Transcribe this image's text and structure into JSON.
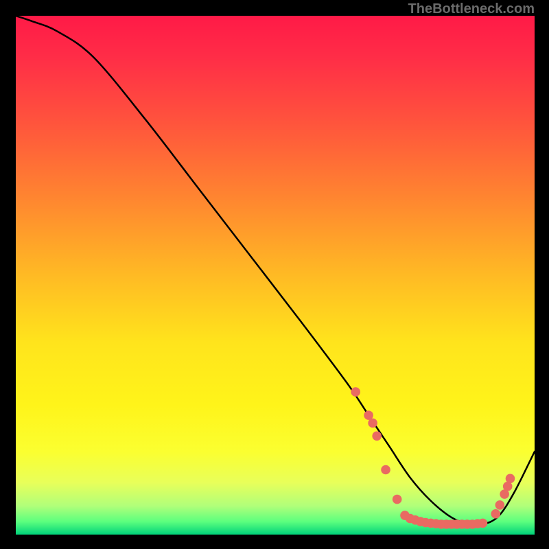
{
  "attribution": "TheBottleneck.com",
  "chart_data": {
    "type": "line",
    "title": "",
    "xlabel": "",
    "ylabel": "",
    "xlim": [
      0,
      100
    ],
    "ylim": [
      0,
      100
    ],
    "grid": false,
    "gradient_stops": [
      {
        "offset": 0,
        "color": "#ff1a47"
      },
      {
        "offset": 0.08,
        "color": "#ff2d47"
      },
      {
        "offset": 0.2,
        "color": "#ff523d"
      },
      {
        "offset": 0.35,
        "color": "#ff8530"
      },
      {
        "offset": 0.5,
        "color": "#ffba24"
      },
      {
        "offset": 0.63,
        "color": "#ffe41c"
      },
      {
        "offset": 0.75,
        "color": "#fff41a"
      },
      {
        "offset": 0.84,
        "color": "#fbff30"
      },
      {
        "offset": 0.9,
        "color": "#e8ff5a"
      },
      {
        "offset": 0.945,
        "color": "#b0ff7a"
      },
      {
        "offset": 0.975,
        "color": "#5cff7e"
      },
      {
        "offset": 1.0,
        "color": "#00d27a"
      }
    ],
    "series": [
      {
        "name": "bottleneck-curve",
        "color": "#000000",
        "x": [
          0,
          3,
          8,
          15,
          25,
          35,
          45,
          55,
          64,
          68,
          72,
          76,
          80,
          84,
          87,
          90,
          93,
          96,
          100
        ],
        "y": [
          100,
          99,
          97,
          92,
          80,
          67,
          54,
          41,
          29,
          23,
          17,
          11,
          6.5,
          3.3,
          2.2,
          2.0,
          3.5,
          8.0,
          16
        ]
      }
    ],
    "markers": {
      "color": "#e96a62",
      "radius_pct": 0.9,
      "points": [
        {
          "x": 65.5,
          "y": 27.5
        },
        {
          "x": 68.0,
          "y": 23.0
        },
        {
          "x": 68.8,
          "y": 21.5
        },
        {
          "x": 69.6,
          "y": 19.0
        },
        {
          "x": 71.3,
          "y": 12.5
        },
        {
          "x": 73.5,
          "y": 6.8
        },
        {
          "x": 75.0,
          "y": 3.7
        },
        {
          "x": 76.0,
          "y": 3.1
        },
        {
          "x": 77.0,
          "y": 2.8
        },
        {
          "x": 78.0,
          "y": 2.5
        },
        {
          "x": 79.0,
          "y": 2.3
        },
        {
          "x": 80.0,
          "y": 2.2
        },
        {
          "x": 81.0,
          "y": 2.1
        },
        {
          "x": 82.0,
          "y": 2.0
        },
        {
          "x": 83.0,
          "y": 2.0
        },
        {
          "x": 84.0,
          "y": 2.0
        },
        {
          "x": 85.0,
          "y": 2.0
        },
        {
          "x": 86.0,
          "y": 2.0
        },
        {
          "x": 87.0,
          "y": 2.0
        },
        {
          "x": 88.0,
          "y": 2.0
        },
        {
          "x": 89.0,
          "y": 2.1
        },
        {
          "x": 90.0,
          "y": 2.2
        },
        {
          "x": 92.5,
          "y": 4.0
        },
        {
          "x": 93.3,
          "y": 5.7
        },
        {
          "x": 94.2,
          "y": 7.8
        },
        {
          "x": 94.8,
          "y": 9.3
        },
        {
          "x": 95.3,
          "y": 10.8
        }
      ]
    }
  }
}
